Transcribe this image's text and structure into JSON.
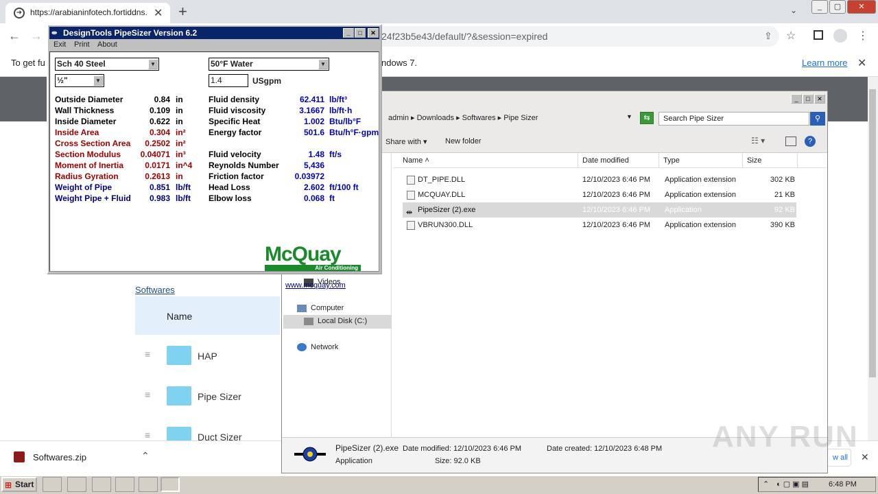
{
  "browser": {
    "tab_title": "https://arabianinfotech.fortiddns.com",
    "tab_close": "✕",
    "new_tab": "+",
    "url_tail": "24f23b5e43/default/?&session=expired",
    "info_text": "To get fu",
    "info_text2": "ndows 7.",
    "learn_more": "Learn more",
    "info_close": "✕"
  },
  "page": {
    "breadcrumb": "Softwares",
    "name_header": "Name",
    "rows": [
      "HAP",
      "Pipe Sizer",
      "Duct Sizer"
    ]
  },
  "downloads": {
    "file": "Softwares.zip",
    "show_all": "w all",
    "close": "✕"
  },
  "explorer": {
    "breadcrumbs": [
      "admin",
      "Downloads",
      "Softwares",
      "Pipe Sizer"
    ],
    "search_placeholder": "Search Pipe Sizer",
    "cmd": {
      "share": "Share with",
      "new_folder": "New folder"
    },
    "columns": {
      "name": "Name",
      "date": "Date modified",
      "type": "Type",
      "size": "Size"
    },
    "files": [
      {
        "name": "DT_PIPE.DLL",
        "date": "12/10/2023 6:46 PM",
        "type": "Application extension",
        "size": "302 KB"
      },
      {
        "name": "MCQUAY.DLL",
        "date": "12/10/2023 6:46 PM",
        "type": "Application extension",
        "size": "21 KB"
      },
      {
        "name": "PipeSizer (2).exe",
        "date": "12/10/2023 6:46 PM",
        "type": "Application",
        "size": "92 KB"
      },
      {
        "name": "VBRUN300.DLL",
        "date": "12/10/2023 6:46 PM",
        "type": "Application extension",
        "size": "390 KB"
      }
    ],
    "nav": {
      "videos": "Videos",
      "computer": "Computer",
      "local_disk": "Local Disk (C:)",
      "network": "Network"
    },
    "details": {
      "name": "PipeSizer (2).exe",
      "modified": "Date modified: 12/10/2023 6:46 PM",
      "created": "Date created: 12/10/2023 6:48 PM",
      "type": "Application",
      "size": "Size: 92.0 KB"
    }
  },
  "pipesizer": {
    "title": "DesignTools PipeSizer Version 6.2",
    "menu": [
      "Exit",
      "Print",
      "About"
    ],
    "pipe_type": "Sch 40 Steel",
    "pipe_size": "½\"",
    "fluid": "50°F Water",
    "flow": "1.4",
    "flow_unit": "USgpm",
    "left": [
      {
        "label": "Outside Diameter",
        "value": "0.84",
        "unit": "in",
        "color": "blk"
      },
      {
        "label": "Wall Thickness",
        "value": "0.109",
        "unit": "in",
        "color": "blk"
      },
      {
        "label": "Inside Diameter",
        "value": "0.622",
        "unit": "in",
        "color": "blk"
      },
      {
        "label": "Inside Area",
        "value": "0.304",
        "unit": "in²",
        "color": "red"
      },
      {
        "label": "Cross Section Area",
        "value": "0.2502",
        "unit": "in²",
        "color": "red"
      },
      {
        "label": "Section Modulus",
        "value": "0.04071",
        "unit": "in³",
        "color": "red"
      },
      {
        "label": "Moment of Inertia",
        "value": "0.0171",
        "unit": "in^4",
        "color": "red"
      },
      {
        "label": "Radius Gyration",
        "value": "0.2613",
        "unit": "in",
        "color": "red"
      },
      {
        "label": "Weight of Pipe",
        "value": "0.851",
        "unit": "lb/ft",
        "color": "navy"
      },
      {
        "label": "Weight Pipe + Fluid",
        "value": "0.983",
        "unit": "lb/ft",
        "color": "navy"
      }
    ],
    "right": [
      {
        "label": "Fluid density",
        "value": "62.411",
        "unit": "lb/ft³"
      },
      {
        "label": "Fluid viscosity",
        "value": "3.1667",
        "unit": "lb/ft·h"
      },
      {
        "label": "Specific Heat",
        "value": "1.002",
        "unit": "Btu/lb°F"
      },
      {
        "label": "Energy factor",
        "value": "501.6",
        "unit": "Btu/h°F·gpm"
      },
      {
        "label": "",
        "value": "",
        "unit": ""
      },
      {
        "label": "Fluid velocity",
        "value": "1.48",
        "unit": "ft/s"
      },
      {
        "label": "Reynolds Number",
        "value": "5,436",
        "unit": ""
      },
      {
        "label": "Friction factor",
        "value": "0.03972",
        "unit": ""
      },
      {
        "label": "Head Loss",
        "value": "2.602",
        "unit": "ft/100 ft"
      },
      {
        "label": "Elbow loss",
        "value": "0.068",
        "unit": "ft"
      }
    ],
    "logo_text": "McQuay",
    "logo_sub": "Air Conditioning",
    "link": "www.mcquay.com"
  },
  "taskbar": {
    "start": "Start",
    "time": "6:48 PM"
  },
  "watermark": "ANY RUN"
}
